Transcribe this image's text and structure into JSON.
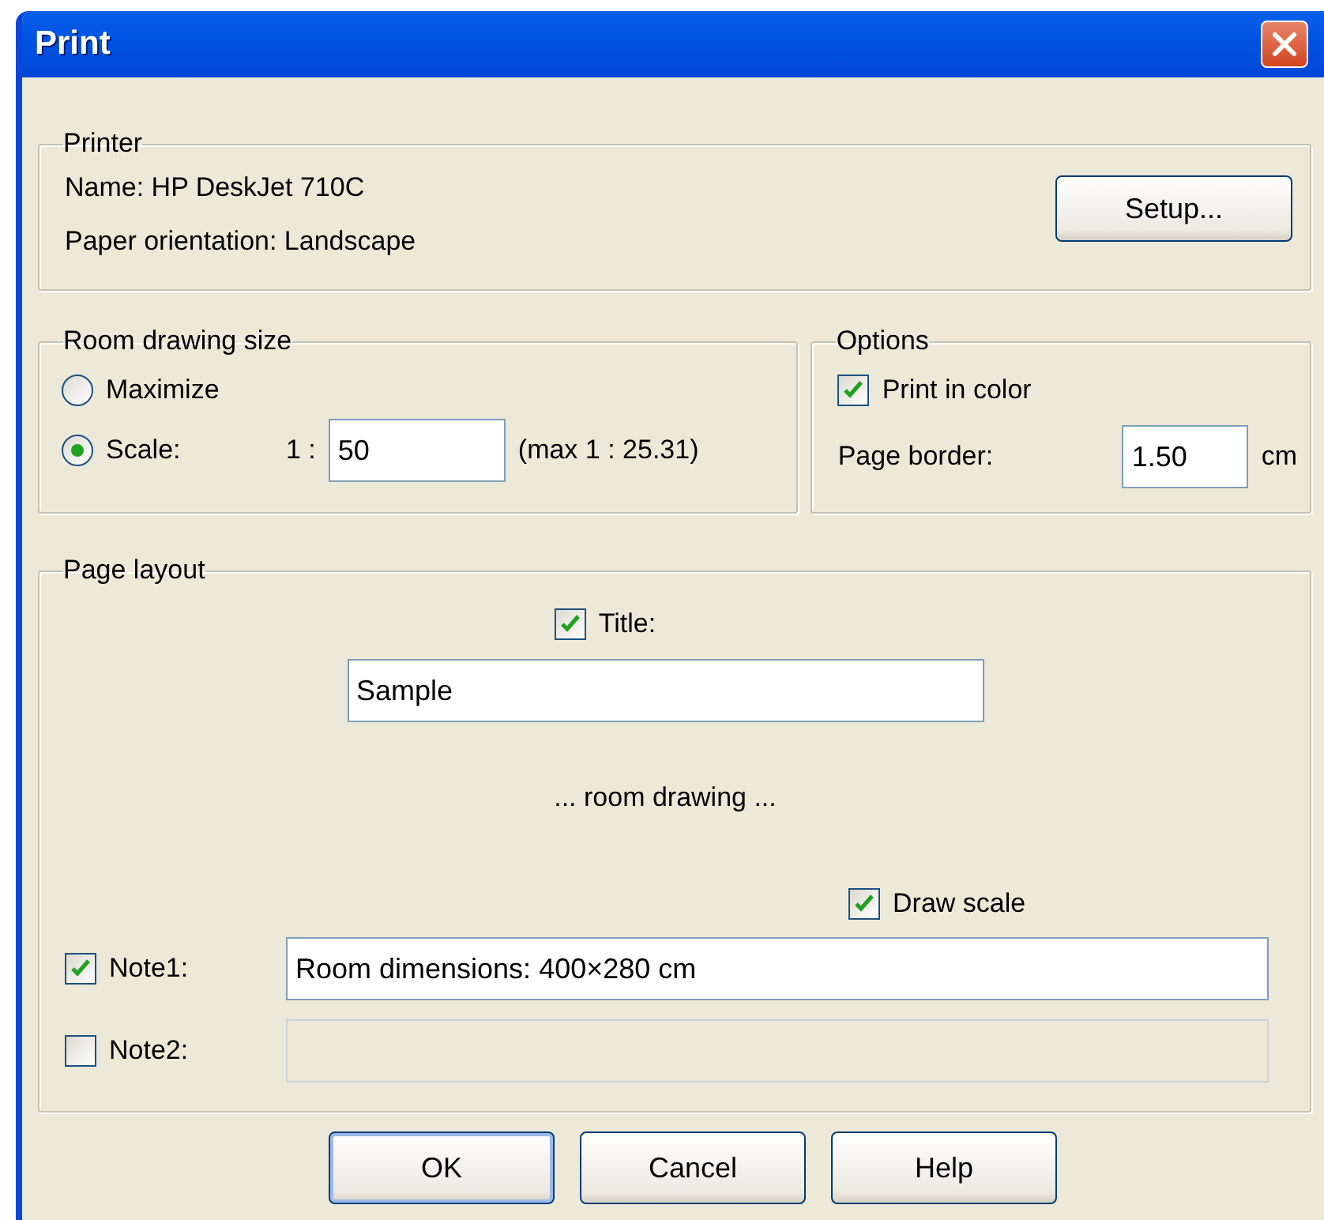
{
  "window": {
    "title": "Print"
  },
  "printer": {
    "label": "Printer",
    "name": "Name: HP DeskJet 710C",
    "orientation": "Paper orientation: Landscape",
    "setup_button": "Setup..."
  },
  "room_drawing_size": {
    "label": "Room drawing size",
    "options": [
      {
        "label": "Maximize",
        "selected": false
      },
      {
        "label": "Scale:",
        "selected": true
      }
    ],
    "ratio_prefix": "1 :",
    "scale_value": "50",
    "max_note": "(max 1 : 25.31)"
  },
  "options": {
    "label": "Options",
    "print_in_color": {
      "label": "Print in color",
      "checked": true
    },
    "page_border_label": "Page border:",
    "page_border_value": "1.50",
    "unit": "cm"
  },
  "page_layout": {
    "label": "Page layout",
    "title": {
      "label": "Title:",
      "checked": true,
      "value": "Sample"
    },
    "drawing_caption": "... room drawing ...",
    "draw_scale": {
      "label": "Draw scale",
      "checked": true
    },
    "notes": [
      {
        "label": "Note1:",
        "checked": true,
        "value": "Room dimensions: 400×280 cm"
      },
      {
        "label": "Note2:",
        "checked": false
      }
    ]
  },
  "buttons": [
    {
      "label": "OK",
      "default": true
    },
    {
      "label": "Cancel",
      "default": false
    },
    {
      "label": "Help",
      "default": false
    }
  ]
}
